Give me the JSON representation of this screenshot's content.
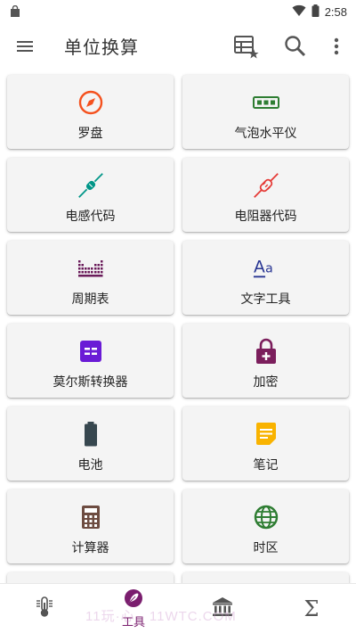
{
  "status_bar": {
    "time": "2:58"
  },
  "app_bar": {
    "title": "单位换算"
  },
  "tools": [
    {
      "label": "罗盘",
      "icon": "compass-icon",
      "color": "#f4511e"
    },
    {
      "label": "气泡水平仪",
      "icon": "level-icon",
      "color": "#2e7d32"
    },
    {
      "label": "电感代码",
      "icon": "inductor-icon",
      "color": "#009688"
    },
    {
      "label": "电阻器代码",
      "icon": "resistor-icon",
      "color": "#e53935"
    },
    {
      "label": "周期表",
      "icon": "periodic-table-icon",
      "color": "#6a1b5a"
    },
    {
      "label": "文字工具",
      "icon": "text-tools-icon",
      "color": "#283593"
    },
    {
      "label": "莫尔斯转换器",
      "icon": "morse-icon",
      "color": "#6a1bd6"
    },
    {
      "label": "加密",
      "icon": "lock-icon",
      "color": "#7b1e5c"
    },
    {
      "label": "电池",
      "icon": "battery-icon",
      "color": "#37474f"
    },
    {
      "label": "笔记",
      "icon": "note-icon",
      "color": "#f9b300"
    },
    {
      "label": "计算器",
      "icon": "calculator-icon",
      "color": "#6d4c41"
    },
    {
      "label": "时区",
      "icon": "globe-icon",
      "color": "#2e7d32"
    }
  ],
  "bottom_nav": {
    "active_label": "工具",
    "sigma": "Σ",
    "active_color": "#7a1e6e"
  },
  "watermark": "11玩·心 · 11WTC.COM"
}
